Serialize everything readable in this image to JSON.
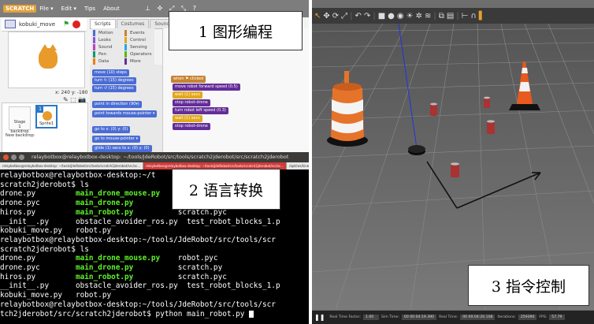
{
  "scratch": {
    "logo": "SCRATCH",
    "menu": [
      "File ▾",
      "Edit ▾",
      "Tips",
      "About"
    ],
    "toolbar_icons": "⊥ ✣ ⤢ ⤡ ?",
    "sprite_name": "kobuki_move",
    "stage_coords": "x: 240  y: -180",
    "tabs": [
      "Scripts",
      "Costumes",
      "Sounds"
    ],
    "categories": [
      {
        "label": "Motion",
        "color": "#4a6cd4"
      },
      {
        "label": "Events",
        "color": "#c88330"
      },
      {
        "label": "Looks",
        "color": "#8a55d7"
      },
      {
        "label": "Control",
        "color": "#e1a91a"
      },
      {
        "label": "Sound",
        "color": "#bb42c3"
      },
      {
        "label": "Sensing",
        "color": "#2ca5e2"
      },
      {
        "label": "Pen",
        "color": "#0e9a6c"
      },
      {
        "label": "Operators",
        "color": "#5cb712"
      },
      {
        "label": "Data",
        "color": "#ee7d16"
      },
      {
        "label": "More Blocks",
        "color": "#632d99"
      }
    ],
    "palette_blocks": [
      "move (10) steps",
      "turn ↻ (15) degrees",
      "turn ↺ (15) degrees",
      "point in direction (90▾)",
      "point towards mouse-pointer ▾",
      "go to x: (0) y: (0)",
      "go to mouse-pointer ▾",
      "glide (1) secs to x: (0) y: (0)"
    ],
    "script_blocks": [
      {
        "text": "when ⚑ clicked",
        "color": "#c88330"
      },
      {
        "text": "move robot  forward  speed (0.5)",
        "color": "#632d99"
      },
      {
        "text": "wait (1) secs",
        "color": "#e1a91a"
      },
      {
        "text": "stop robot-drone",
        "color": "#632d99"
      },
      {
        "text": "turn robot  left  speed (0.3)",
        "color": "#632d99"
      },
      {
        "text": "wait (1) secs",
        "color": "#e1a91a"
      },
      {
        "text": "stop robot-drone",
        "color": "#632d99"
      }
    ],
    "stage_thumb_label": "Stage\n1 backdrop",
    "sprite_thumb_label": "Sprite1",
    "sprite_thumb_index": "1",
    "new_backdrop_label": "New backdrop:",
    "sprite_tools": "✎ ⬚ 📷",
    "label": "1 图形编程"
  },
  "terminal": {
    "title": "relaybotbox@relaybotbox-desktop: ~/tools/JdeRobot/src/tools/scratch2jderobot/src/scratch2jderobot",
    "tabs": [
      "relaybotbox@relaybotbox-desktop: ~/tools/JdeRobot/src/tools/scratch2jderobot/src/sc...",
      "relaybotbox@relaybotbox-desktop: ~/tools/JdeRobot/src/tools/scratch2jderobot/src/sc...",
      "/opt/ros/kinetic/share/kobuki_gazebo/launch/kobuki_empty_world.launch"
    ],
    "lines": [
      [
        {
          "t": "relaybotbox@relaybotbox-desktop:~/t"
        }
      ],
      [
        {
          "t": "scratch2jderobot$ ls"
        }
      ],
      [
        {
          "t": "drone.py         "
        },
        {
          "t": "main_drone_mouse.py",
          "g": true
        }
      ],
      [
        {
          "t": "drone.pyc        "
        },
        {
          "t": "main_drone.py",
          "g": true
        }
      ],
      [
        {
          "t": "hiros.py         "
        },
        {
          "t": "main_robot.py",
          "g": true
        },
        {
          "t": "          scratch.pyc"
        }
      ],
      [
        {
          "t": "__init__.py      obstacle_avoider_ros.py  test_robot_blocks_1.p"
        }
      ],
      [
        {
          "t": "kobuki_move.py   robot.py"
        }
      ],
      [
        {
          "t": "relaybotbox@relaybotbox-desktop:~/tools/JdeRobot/src/tools/scr"
        }
      ],
      [
        {
          "t": "scratch2jderobot$ ls"
        }
      ],
      [
        {
          "t": "drone.py         "
        },
        {
          "t": "main_drone_mouse.py",
          "g": true
        },
        {
          "t": "    robot.pyc"
        }
      ],
      [
        {
          "t": "drone.pyc        "
        },
        {
          "t": "main_drone.py",
          "g": true
        },
        {
          "t": "          scratch.py"
        }
      ],
      [
        {
          "t": "hiros.py         "
        },
        {
          "t": "main_robot.py",
          "g": true
        },
        {
          "t": "          scratch.pyc"
        }
      ],
      [
        {
          "t": "__init__.py      obstacle_avoider_ros.py  test_robot_blocks_1.p"
        }
      ],
      [
        {
          "t": "kobuki_move.py   robot.py"
        }
      ],
      [
        {
          "t": "relaybotbox@relaybotbox-desktop:~/tools/JdeRobot/src/tools/scr"
        }
      ],
      [
        {
          "t": "tch2jderobot/src/scratch2jderobot$ python main_robot.py "
        }
      ]
    ],
    "label": "2 语言转换"
  },
  "gazebo": {
    "toolbar_icons": [
      {
        "i": "↖",
        "on": true
      },
      {
        "i": "✥"
      },
      {
        "i": "⟳"
      },
      {
        "i": "⤢"
      },
      {
        "i": "|",
        "sep": true
      },
      {
        "i": "↶"
      },
      {
        "i": "↷"
      },
      {
        "i": "|",
        "sep": true
      },
      {
        "i": "■"
      },
      {
        "i": "●"
      },
      {
        "i": "◉"
      },
      {
        "i": "☀"
      },
      {
        "i": "✲"
      },
      {
        "i": "≋"
      },
      {
        "i": "|",
        "sep": true
      },
      {
        "i": "⧉"
      },
      {
        "i": "▤"
      },
      {
        "i": "|",
        "sep": true
      },
      {
        "i": "⊢"
      },
      {
        "i": "∩"
      },
      {
        "i": "▌",
        "on": true
      }
    ],
    "status": {
      "pause": "❚❚",
      "items": [
        {
          "k": "Real Time Factor:",
          "v": "1.00"
        },
        {
          "k": "Sim Time:",
          "v": "00 00:04:19.390"
        },
        {
          "k": "Real Time:",
          "v": "00 00:04:20.108"
        },
        {
          "k": "Iterations:",
          "v": "259390"
        },
        {
          "k": "FPS:",
          "v": "57.79"
        }
      ]
    },
    "label": "3 指令控制"
  }
}
